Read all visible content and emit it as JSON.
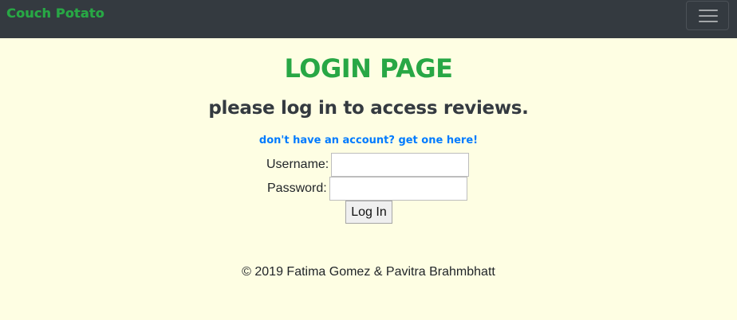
{
  "navbar": {
    "brand": "Couch Potato",
    "toggler_icon": "hamburger-menu-icon"
  },
  "main": {
    "title": "Login Page",
    "subtitle": "Please Log in to access reviews.",
    "signup_link": "Don't have an account? Get one here!"
  },
  "form": {
    "username_label": "Username:",
    "username_value": "",
    "password_label": "Password:",
    "password_value": "",
    "submit_label": "Log In"
  },
  "footer": {
    "text": "© 2019 Fatima Gomez & Pavitra Brahmbhatt"
  },
  "colors": {
    "background": "#fefee3",
    "navbar": "#343a40",
    "brand": "#28a745",
    "link": "#007bff"
  }
}
